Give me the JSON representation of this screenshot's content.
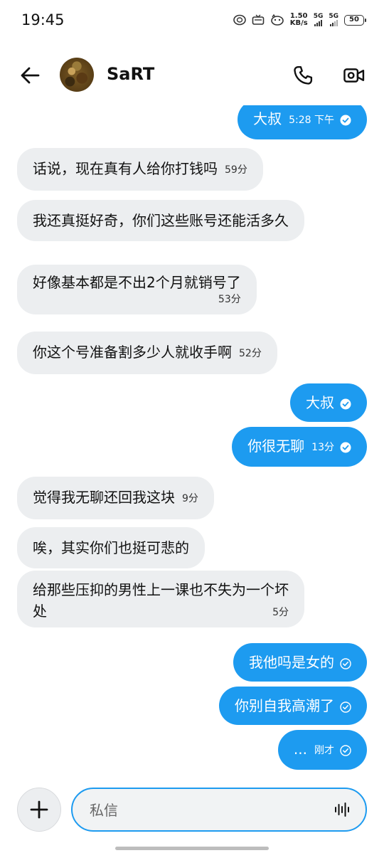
{
  "status_bar": {
    "time": "19:45",
    "net_speed_value": "1.50",
    "net_speed_unit": "KB/s",
    "signal1": "5G",
    "signal2": "5G",
    "battery": "50"
  },
  "header": {
    "contact_name": "SaRT"
  },
  "messages": [
    {
      "dir": "out",
      "text": "大叔",
      "meta": "5:28 下午"
    },
    {
      "dir": "in",
      "text": "话说，现在真有人给你打钱吗",
      "meta": "59分"
    },
    {
      "dir": "in",
      "text": "我还真挺好奇，你们这些账号还能活多久",
      "meta": ""
    },
    {
      "dir": "in",
      "text": "好像基本都是不出2个月就销号了",
      "meta": "53分"
    },
    {
      "dir": "in",
      "text": "你这个号准备割多少人就收手啊",
      "meta": "52分"
    },
    {
      "dir": "out",
      "text": "大叔",
      "meta": ""
    },
    {
      "dir": "out",
      "text": "你很无聊",
      "meta": "13分"
    },
    {
      "dir": "in",
      "text": "觉得我无聊还回我这块",
      "meta": "9分"
    },
    {
      "dir": "in",
      "text": "唉，其实你们也挺可悲的",
      "meta": ""
    },
    {
      "dir": "in",
      "text": "给那些压抑的男性上一课也不失为一个坏处",
      "meta": "5分"
    },
    {
      "dir": "out",
      "text": "我他吗是女的",
      "meta": ""
    },
    {
      "dir": "out",
      "text": "你别自我高潮了",
      "meta": ""
    },
    {
      "dir": "out",
      "text": "...",
      "meta": "刚才"
    }
  ],
  "composer": {
    "placeholder": "私信"
  },
  "colors": {
    "accent": "#1d9bf0",
    "incoming_bubble": "#eceef0",
    "background": "#ffffff"
  },
  "icons": [
    "back-arrow-icon",
    "phone-icon",
    "video-camera-icon",
    "plus-icon",
    "voice-waveform-icon",
    "sent-check-icon",
    "read-check-icon"
  ]
}
